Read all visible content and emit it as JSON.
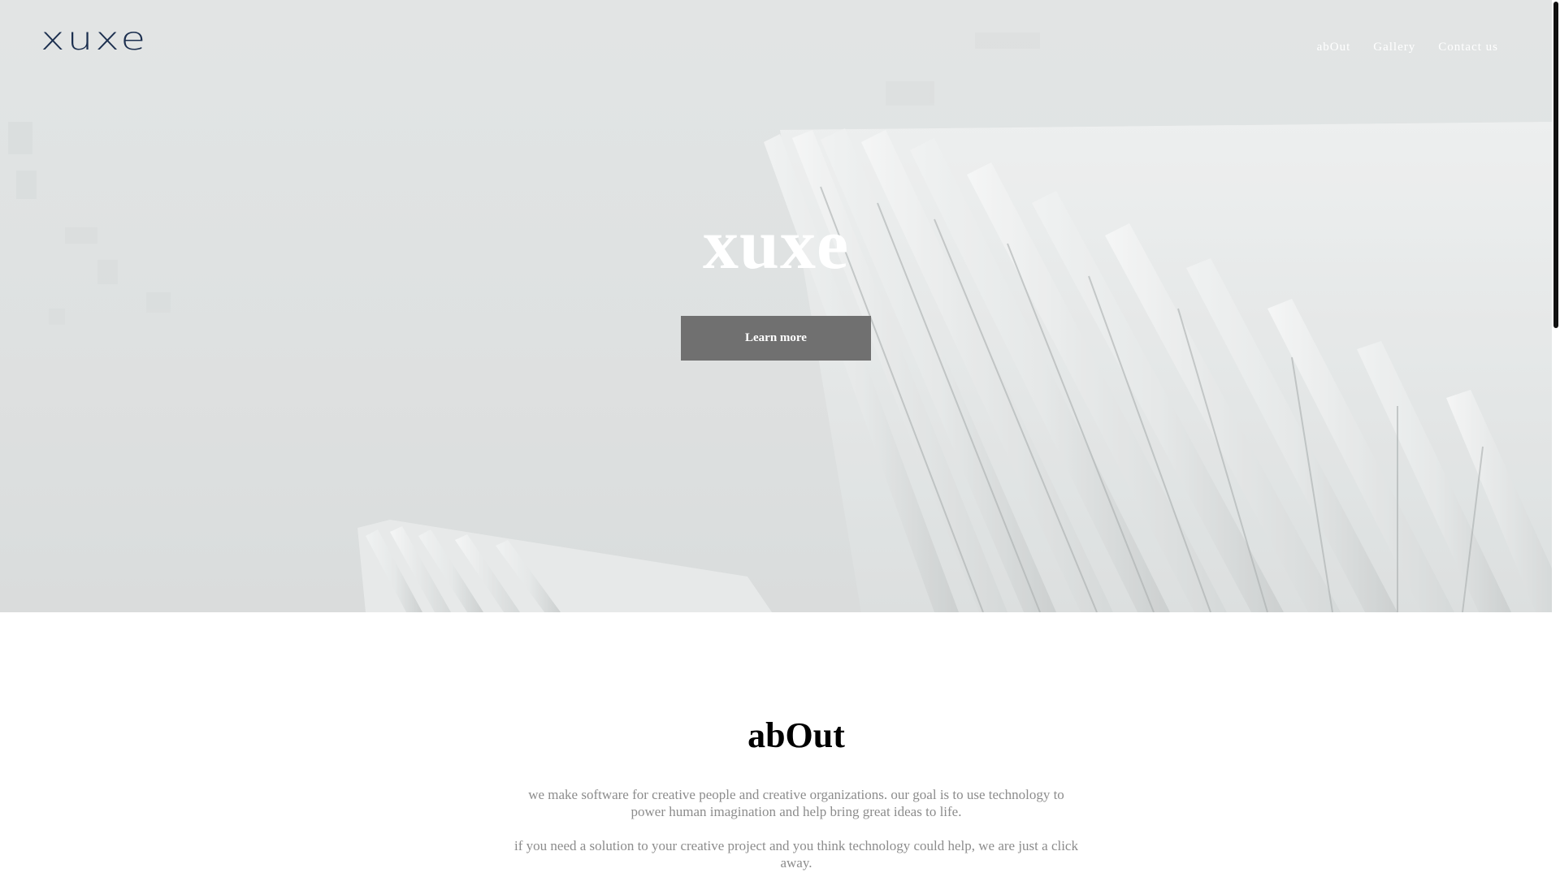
{
  "header": {
    "logo": "xuxe",
    "nav": [
      {
        "label": "abOut"
      },
      {
        "label": "Gallery"
      },
      {
        "label": "Contact us"
      }
    ]
  },
  "hero": {
    "title": "xuxe",
    "cta_label": "Learn more",
    "background": "white architectural fins photograph"
  },
  "about": {
    "title": "abOut",
    "paragraphs": [
      "we make software for creative people and creative organizations. our goal is to use technology to power human imagination and help bring great ideas to life.",
      "if you need a solution to your creative project and you think technology could help, we are just a click away."
    ]
  },
  "colors": {
    "logo": "#1c2f4f",
    "cta_bg": "#707070",
    "body_text": "#8c8c8c"
  }
}
